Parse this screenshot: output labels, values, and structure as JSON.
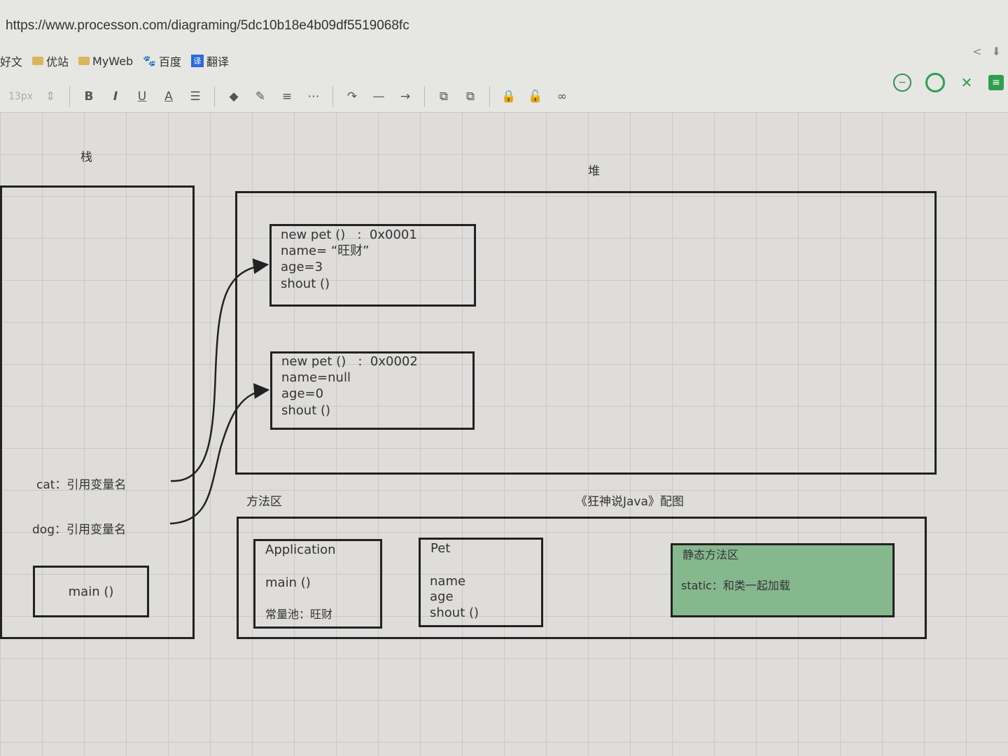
{
  "browser": {
    "url": "https://www.processon.com/diagraming/5dc10b18e4b09df5519068fc",
    "bookmarks": [
      {
        "label": "好文"
      },
      {
        "label": "优站"
      },
      {
        "label": "MyWeb"
      },
      {
        "label": "百度"
      },
      {
        "label": "翻译"
      }
    ]
  },
  "toolbar": {
    "font_size": "13px",
    "bold": "B",
    "italic": "I",
    "underline": "U",
    "font_color": "A"
  },
  "diagram": {
    "stack_title": "栈",
    "heap_title": "堆",
    "method_area_title": "方法区",
    "caption": "《狂神说Java》配图",
    "stack": {
      "cat_label": "cat：引用变量名",
      "dog_label": "dog：引用变量名",
      "main_label": "main ()"
    },
    "heap_objects": [
      {
        "lines": [
          "new pet ()   :  0x0001",
          "name= “旺财”",
          "age=3",
          "shout ()"
        ]
      },
      {
        "lines": [
          "new pet ()   :  0x0002",
          "name=null",
          "age=0",
          "shout ()"
        ]
      }
    ],
    "application_class": {
      "lines": [
        "Application",
        "",
        "main ()",
        "",
        "常量池：旺财"
      ]
    },
    "pet_class": {
      "lines": [
        "Pet",
        "",
        "name",
        "age",
        "shout ()"
      ]
    },
    "static_area": {
      "lines": [
        "静态方法区",
        "",
        "static：和类一起加载"
      ],
      "color": "#86b88e"
    }
  }
}
